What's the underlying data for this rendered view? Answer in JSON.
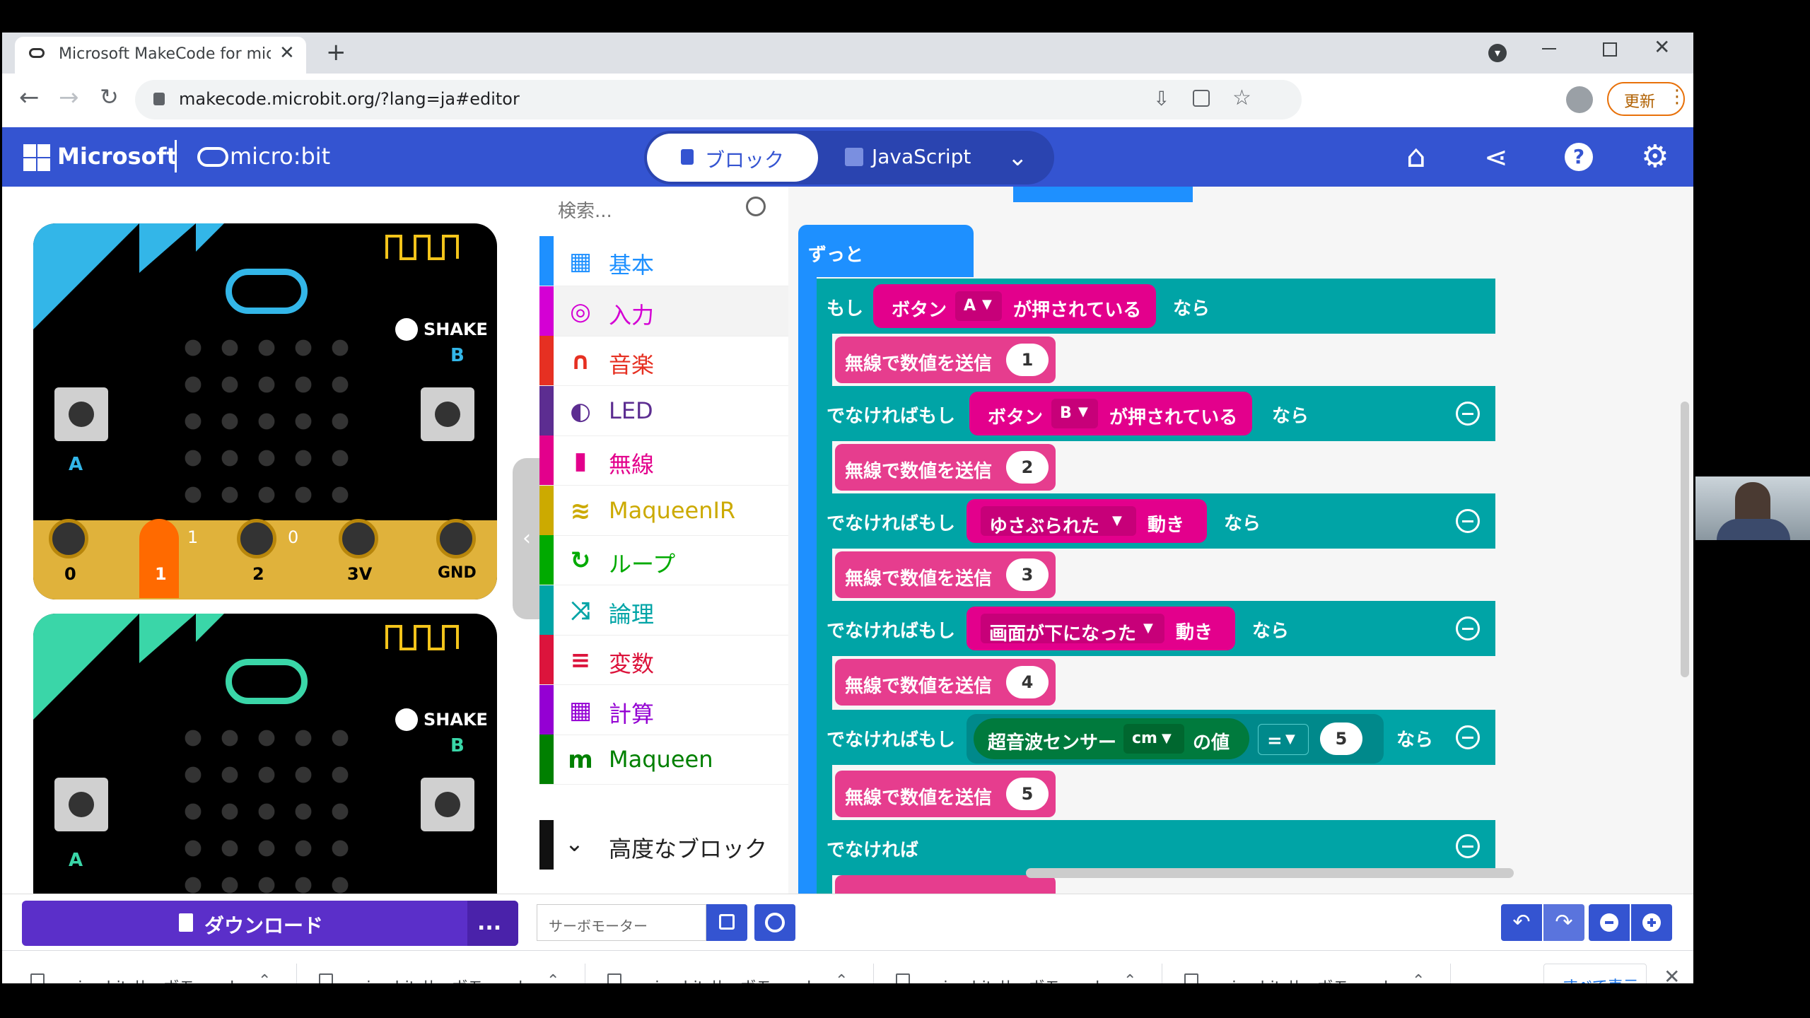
{
  "browser": {
    "tab_title": "Microsoft MakeCode for micro:b",
    "url": "makecode.microbit.org/?lang=ja#editor",
    "update_label": "更新"
  },
  "header": {
    "microsoft": "Microsoft",
    "microbit": "micro:bit",
    "blocks_tab": "ブロック",
    "js_tab": "JavaScript"
  },
  "simulator": {
    "shake": "SHAKE",
    "button_a": "A",
    "button_b": "B",
    "pins": [
      "0",
      "1",
      "2",
      "3V",
      "GND"
    ],
    "pin_readings": [
      "1",
      "0"
    ]
  },
  "toolbox": {
    "search_placeholder": "検索...",
    "categories": [
      {
        "label": "基本",
        "color": "#1e90ff",
        "icon": "grid-icon"
      },
      {
        "label": "入力",
        "color": "#d400d4",
        "icon": "target-icon"
      },
      {
        "label": "音楽",
        "color": "#e63022",
        "icon": "headphones-icon"
      },
      {
        "label": "LED",
        "color": "#5c2d91",
        "icon": "toggle-icon"
      },
      {
        "label": "無線",
        "color": "#e3008c",
        "icon": "signal-icon"
      },
      {
        "label": "MaqueenIR",
        "color": "#ccaa00",
        "icon": "wifi-icon"
      },
      {
        "label": "ループ",
        "color": "#00aa00",
        "icon": "refresh-icon"
      },
      {
        "label": "論理",
        "color": "#00a4a6",
        "icon": "shuffle-icon"
      },
      {
        "label": "変数",
        "color": "#dc143c",
        "icon": "list-icon"
      },
      {
        "label": "計算",
        "color": "#9400d3",
        "icon": "calculator-icon"
      },
      {
        "label": "Maqueen",
        "color": "#008000",
        "icon": "m-icon"
      }
    ],
    "advanced": "高度なブロック"
  },
  "workspace": {
    "forever": "ずっと",
    "if": "もし",
    "else_if": "でなければもし",
    "else": "でなければ",
    "then": "なら",
    "button": "ボタン",
    "pressed": "が押されている",
    "radio_send": "無線で数値を送信",
    "gesture": "動き",
    "button_a": "A",
    "button_b": "B",
    "gesture_shake": "ゆさぶられた",
    "gesture_facedown": "画面が下になった",
    "ultrasonic": "超音波センサー",
    "unit": "cm",
    "value_of": "の値",
    "op": "=",
    "numbers": [
      "1",
      "2",
      "3",
      "4",
      "5",
      "5"
    ]
  },
  "bottombar": {
    "download": "ダウンロード",
    "more": "...",
    "project_name": "サーボモーター"
  },
  "downloads": {
    "items": [
      "microbit-サーボモー....hex",
      "microbit-サーボモー....hex",
      "microbit-サーボモー....hex",
      "microbit-サーボモー....hex",
      "microbit-サーボモー....hex"
    ],
    "show_all": "すべて表示"
  }
}
